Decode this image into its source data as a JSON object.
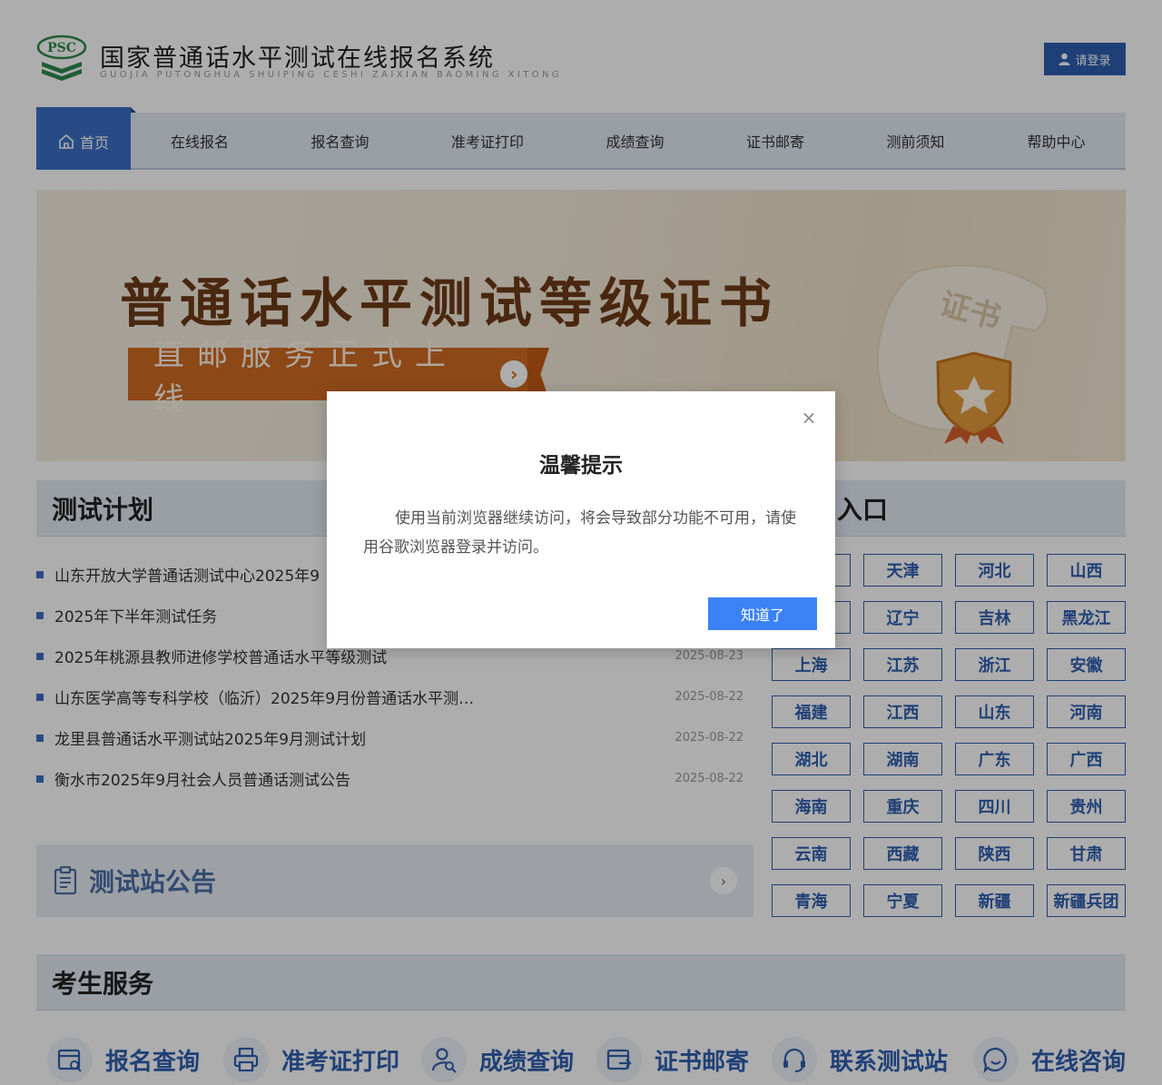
{
  "header": {
    "logo_text": "PSC",
    "title": "国家普通话水平测试在线报名系统",
    "subtitle": "GUOJIA PUTONGHUA SHUIPING CESHI ZAIXIAN BAOMING XITONG",
    "login_label": "请登录"
  },
  "nav": {
    "items": [
      {
        "label": "首页",
        "active": true
      },
      {
        "label": "在线报名"
      },
      {
        "label": "报名查询"
      },
      {
        "label": "准考证打印"
      },
      {
        "label": "成绩查询"
      },
      {
        "label": "证书邮寄"
      },
      {
        "label": "测前须知"
      },
      {
        "label": "帮助中心"
      }
    ]
  },
  "banner": {
    "title": "普通话水平测试等级证书",
    "cta": "直邮服务正式上线",
    "scroll_text": "证书"
  },
  "plan": {
    "heading": "测试计划",
    "items": [
      {
        "title": "山东开放大学普通话测试中心2025年9",
        "date": ""
      },
      {
        "title": "2025年下半年测试任务",
        "date": ""
      },
      {
        "title": "2025年桃源县教师进修学校普通话水平等级测试",
        "date": "2025-08-23"
      },
      {
        "title": "山东医学高等专科学校（临沂）2025年9月份普通话水平测…",
        "date": "2025-08-22"
      },
      {
        "title": "龙里县普通话水平测试站2025年9月测试计划",
        "date": "2025-08-22"
      },
      {
        "title": "衡水市2025年9月社会人员普通话测试公告",
        "date": "2025-08-22"
      }
    ],
    "notice_label": "测试站公告"
  },
  "entry": {
    "heading": "入口",
    "provinces": [
      "",
      "天津",
      "河北",
      "山西",
      "",
      "辽宁",
      "吉林",
      "黑龙江",
      "上海",
      "江苏",
      "浙江",
      "安徽",
      "福建",
      "江西",
      "山东",
      "河南",
      "湖北",
      "湖南",
      "广东",
      "广西",
      "海南",
      "重庆",
      "四川",
      "贵州",
      "云南",
      "西藏",
      "陕西",
      "甘肃",
      "青海",
      "宁夏",
      "新疆",
      "新疆兵团"
    ]
  },
  "services": {
    "heading": "考生服务",
    "items": [
      {
        "label": "报名查询",
        "icon": "registration-query-icon"
      },
      {
        "label": "准考证打印",
        "icon": "printer-icon"
      },
      {
        "label": "成绩查询",
        "icon": "user-search-icon"
      },
      {
        "label": "证书邮寄",
        "icon": "mail-export-icon"
      },
      {
        "label": "联系测试站",
        "icon": "headset-icon"
      },
      {
        "label": "在线咨询",
        "icon": "chat-smile-icon"
      }
    ]
  },
  "modal": {
    "title": "温馨提示",
    "body": "使用当前浏览器继续访问，将会导致部分功能不可用，请使用谷歌浏览器登录并访问。",
    "ok_label": "知道了",
    "close_icon": "close-icon"
  },
  "colors": {
    "primary": "#2e5fb0",
    "nav_active": "#3c6fc6",
    "banner_text": "#6e3a17",
    "banner_cta": "#d06a22",
    "modal_button": "#3b82f6"
  }
}
